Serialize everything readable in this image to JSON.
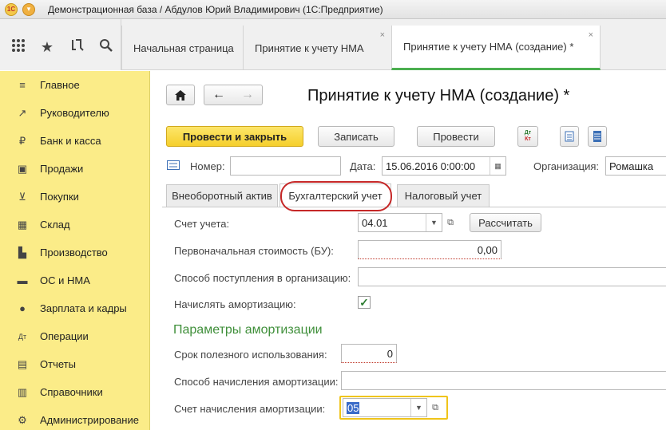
{
  "titlebar": {
    "logo": "1С",
    "title": "Демонстрационная база / Абдулов Юрий Владимирович  (1С:Предприятие)"
  },
  "toolbar_icons": [
    "apps-grid-icon",
    "star-icon",
    "history-icon",
    "search-icon"
  ],
  "tabs": [
    {
      "label": "Начальная страница"
    },
    {
      "label": "Принятие к учету НМА"
    },
    {
      "label": "Принятие к учету НМА (создание) *"
    }
  ],
  "sidebar": {
    "items": [
      {
        "label": "Главное",
        "icon": "menu-lines-icon",
        "glyph": "≡"
      },
      {
        "label": "Руководителю",
        "icon": "trend-chart-icon",
        "glyph": "↗"
      },
      {
        "label": "Банк и касса",
        "icon": "coin-icon",
        "glyph": "₽"
      },
      {
        "label": "Продажи",
        "icon": "bag-icon",
        "glyph": "▣"
      },
      {
        "label": "Покупки",
        "icon": "cart-icon",
        "glyph": "⊻"
      },
      {
        "label": "Склад",
        "icon": "warehouse-icon",
        "glyph": "▦"
      },
      {
        "label": "Производство",
        "icon": "factory-icon",
        "glyph": "▙"
      },
      {
        "label": "ОС и НМА",
        "icon": "truck-icon",
        "glyph": "▬"
      },
      {
        "label": "Зарплата и кадры",
        "icon": "person-icon",
        "glyph": "●"
      },
      {
        "label": "Операции",
        "icon": "debit-credit-icon",
        "glyph": "Дт"
      },
      {
        "label": "Отчеты",
        "icon": "report-icon",
        "glyph": "▤"
      },
      {
        "label": "Справочники",
        "icon": "book-icon",
        "glyph": "▥"
      },
      {
        "label": "Администрирование",
        "icon": "gear-icon",
        "glyph": "⚙"
      }
    ]
  },
  "form": {
    "title": "Принятие к учету НМА (создание) *",
    "buttons": {
      "post_close": "Провести и закрыть",
      "save": "Записать",
      "post": "Провести",
      "dtkt_top": "Дт",
      "dtkt_bottom": "Кт",
      "calc": "Рассчитать"
    },
    "number_label": "Номер:",
    "number_value": "",
    "date_label": "Дата:",
    "date_value": "15.06.2016  0:00:00",
    "org_label": "Организация:",
    "org_value": "Ромашка",
    "tabs": [
      "Внеоборотный актив",
      "Бухгалтерский учет",
      "Налоговый учет"
    ],
    "account_label": "Счет учета:",
    "account_value": "04.01",
    "initial_cost_label": "Первоначальная стоимость (БУ):",
    "initial_cost_value": "0,00",
    "receipt_method_label": "Способ поступления в организацию:",
    "receipt_method_value": "",
    "amortize_label": "Начислять амортизацию:",
    "amortize_checked": true,
    "section_title": "Параметры амортизации",
    "useful_life_label": "Срок полезного использования:",
    "useful_life_value": "0",
    "amort_method_label": "Способ начисления амортизации:",
    "amort_method_value": "",
    "amort_account_label": "Счет начисления амортизации:",
    "amort_account_value": "05"
  }
}
